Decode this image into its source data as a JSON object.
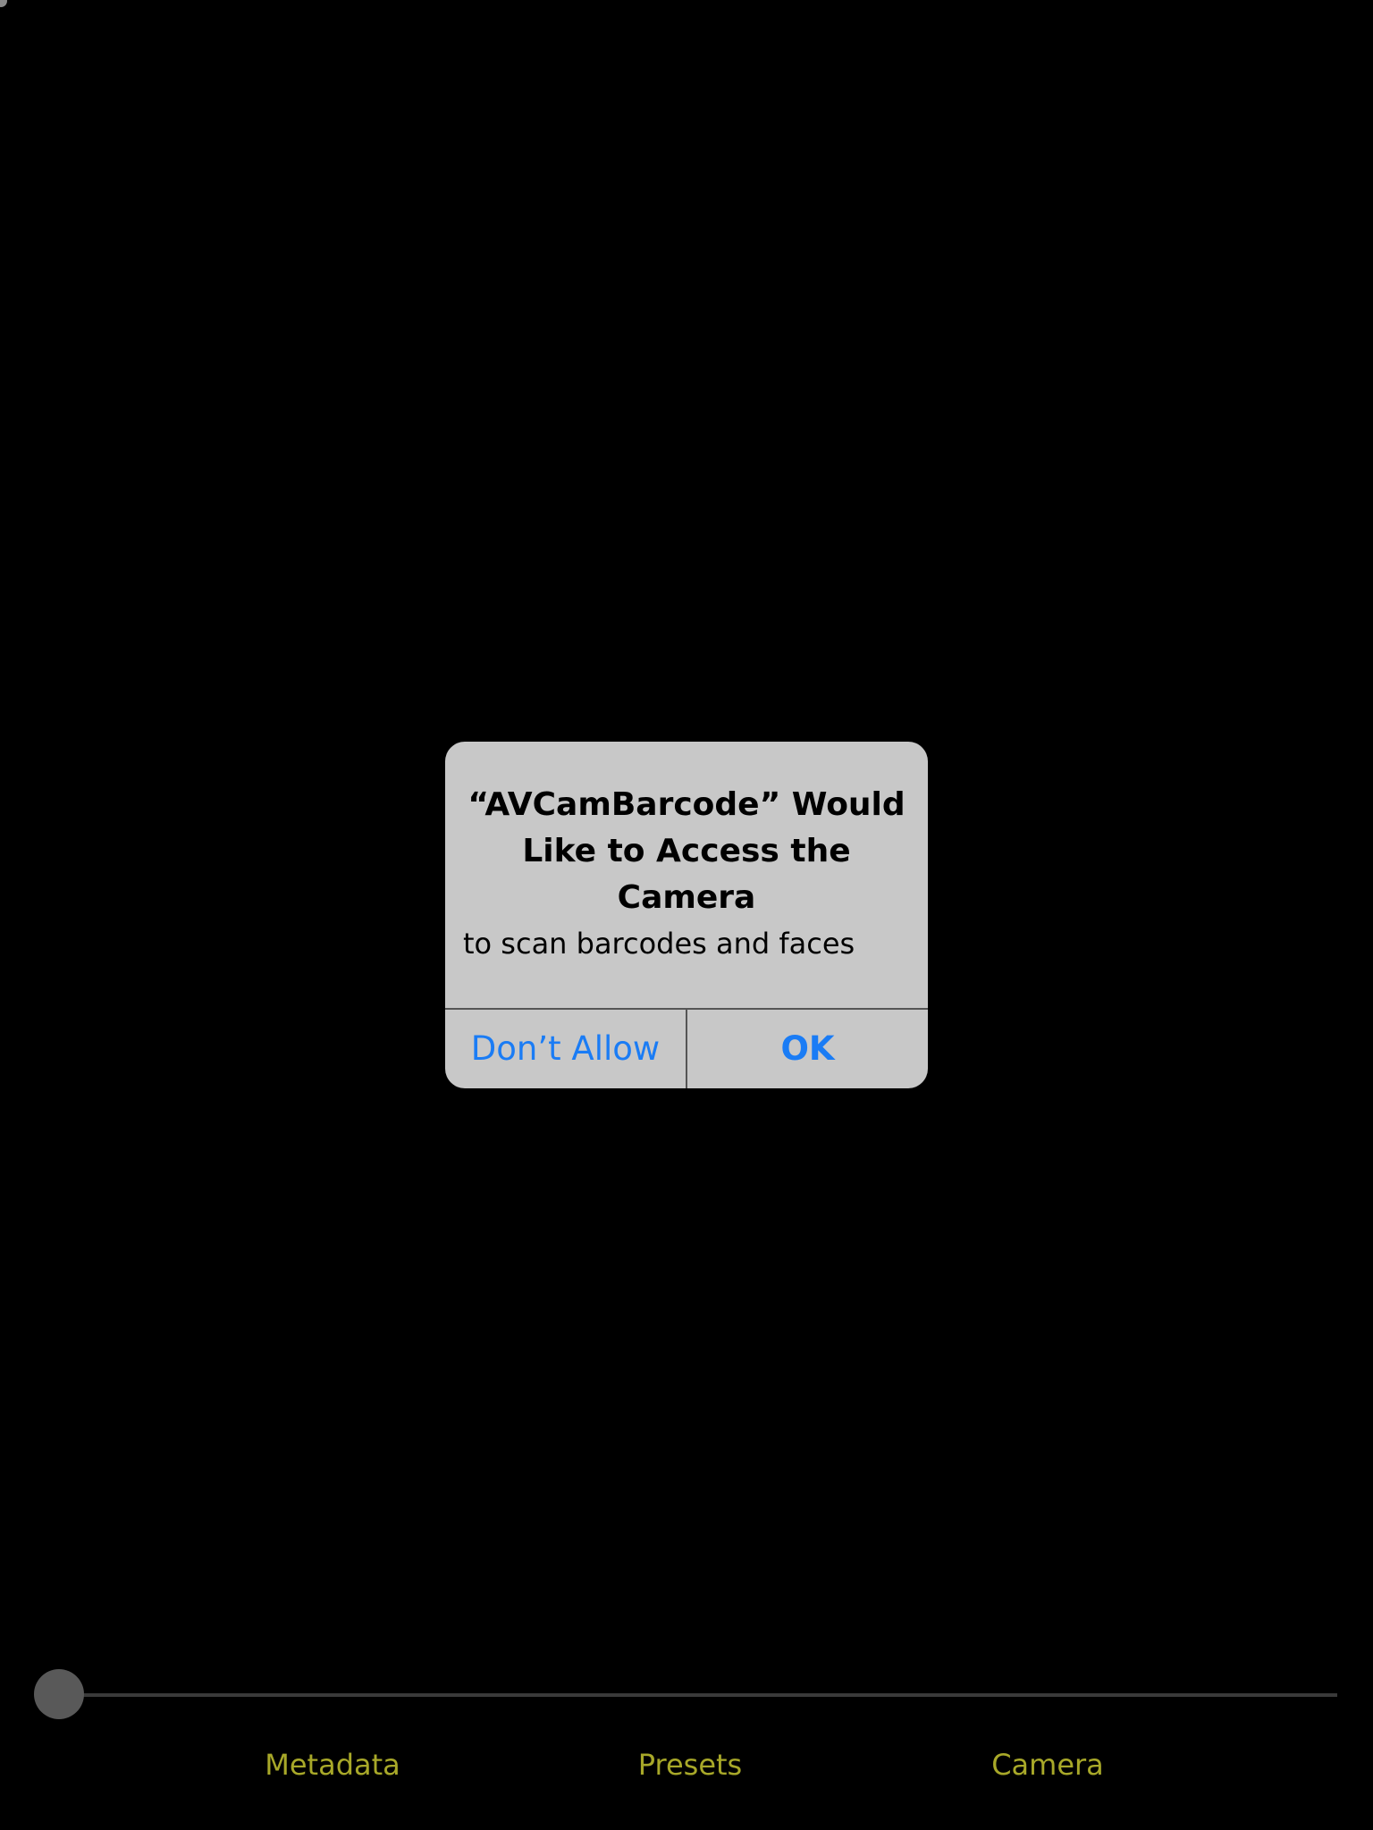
{
  "alert": {
    "title": "“AVCamBarcode” Would Like to Access the Camera",
    "message": "to scan barcodes and faces",
    "buttons": {
      "dont_allow": "Don’t Allow",
      "ok": "OK"
    }
  },
  "slider": {
    "value": 0
  },
  "tabs": [
    {
      "label": "Metadata"
    },
    {
      "label": "Presets"
    },
    {
      "label": "Camera"
    }
  ],
  "colors": {
    "background": "#000000",
    "alert_background": "#c8c8c8",
    "button_blue": "#1a7cf5",
    "tab_text": "#a8a829"
  }
}
